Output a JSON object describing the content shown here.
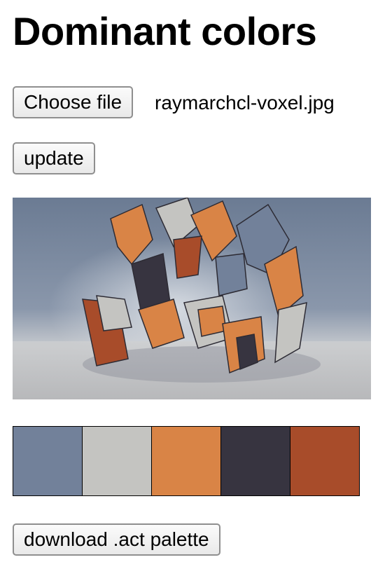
{
  "page": {
    "title": "Dominant colors"
  },
  "file_input": {
    "button_label": "Choose file",
    "file_name": "raymarchcl-voxel.jpg"
  },
  "update_button": {
    "label": "update"
  },
  "image": {
    "description_icon": "rendered-image"
  },
  "palette": {
    "colors": [
      "#72819a",
      "#c4c4c1",
      "#d98446",
      "#373440",
      "#a84c2a"
    ]
  },
  "download_button": {
    "label": "download .act palette"
  }
}
